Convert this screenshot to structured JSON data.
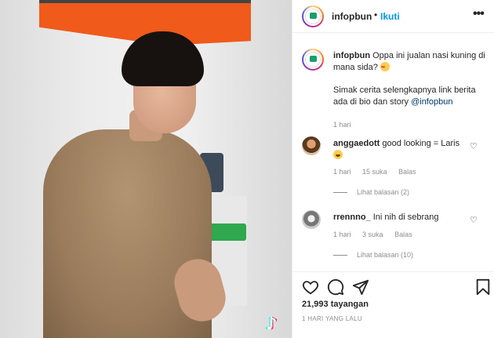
{
  "post": {
    "username": "infopbun",
    "separator": "•",
    "follow_label": "Ikuti",
    "more_label": "•••"
  },
  "caption": {
    "username": "infopbun",
    "text_1": "Oppa ini jualan nasi kuning di mana sida?",
    "text_2": "Simak cerita selengkapnya link berita ada di bio dan story",
    "mention": "@infopbun",
    "time": "1 hari"
  },
  "comments": [
    {
      "username": "anggaedott",
      "text": "good looking = Laris",
      "time": "1 hari",
      "likes": "15 suka",
      "reply_label": "Balas",
      "view_replies": "Lihat balasan (2)"
    },
    {
      "username": "rrennno_",
      "text": "Ini nih di sebrang",
      "time": "1 hari",
      "likes": "3 suka",
      "reply_label": "Balas",
      "view_replies": "Lihat balasan (10)"
    }
  ],
  "footer": {
    "views": "21,993 tayangan",
    "date": "1 HARI YANG LALU"
  },
  "icons": {
    "like": "heart-icon",
    "comment": "comment-bubble-icon",
    "share": "paper-plane-icon",
    "save": "bookmark-icon",
    "watermark": "tiktok-icon"
  },
  "colors": {
    "link_blue": "#0095f6",
    "mention_blue": "#00376b",
    "muted_gray": "#8e8e8e",
    "text": "#262626"
  }
}
